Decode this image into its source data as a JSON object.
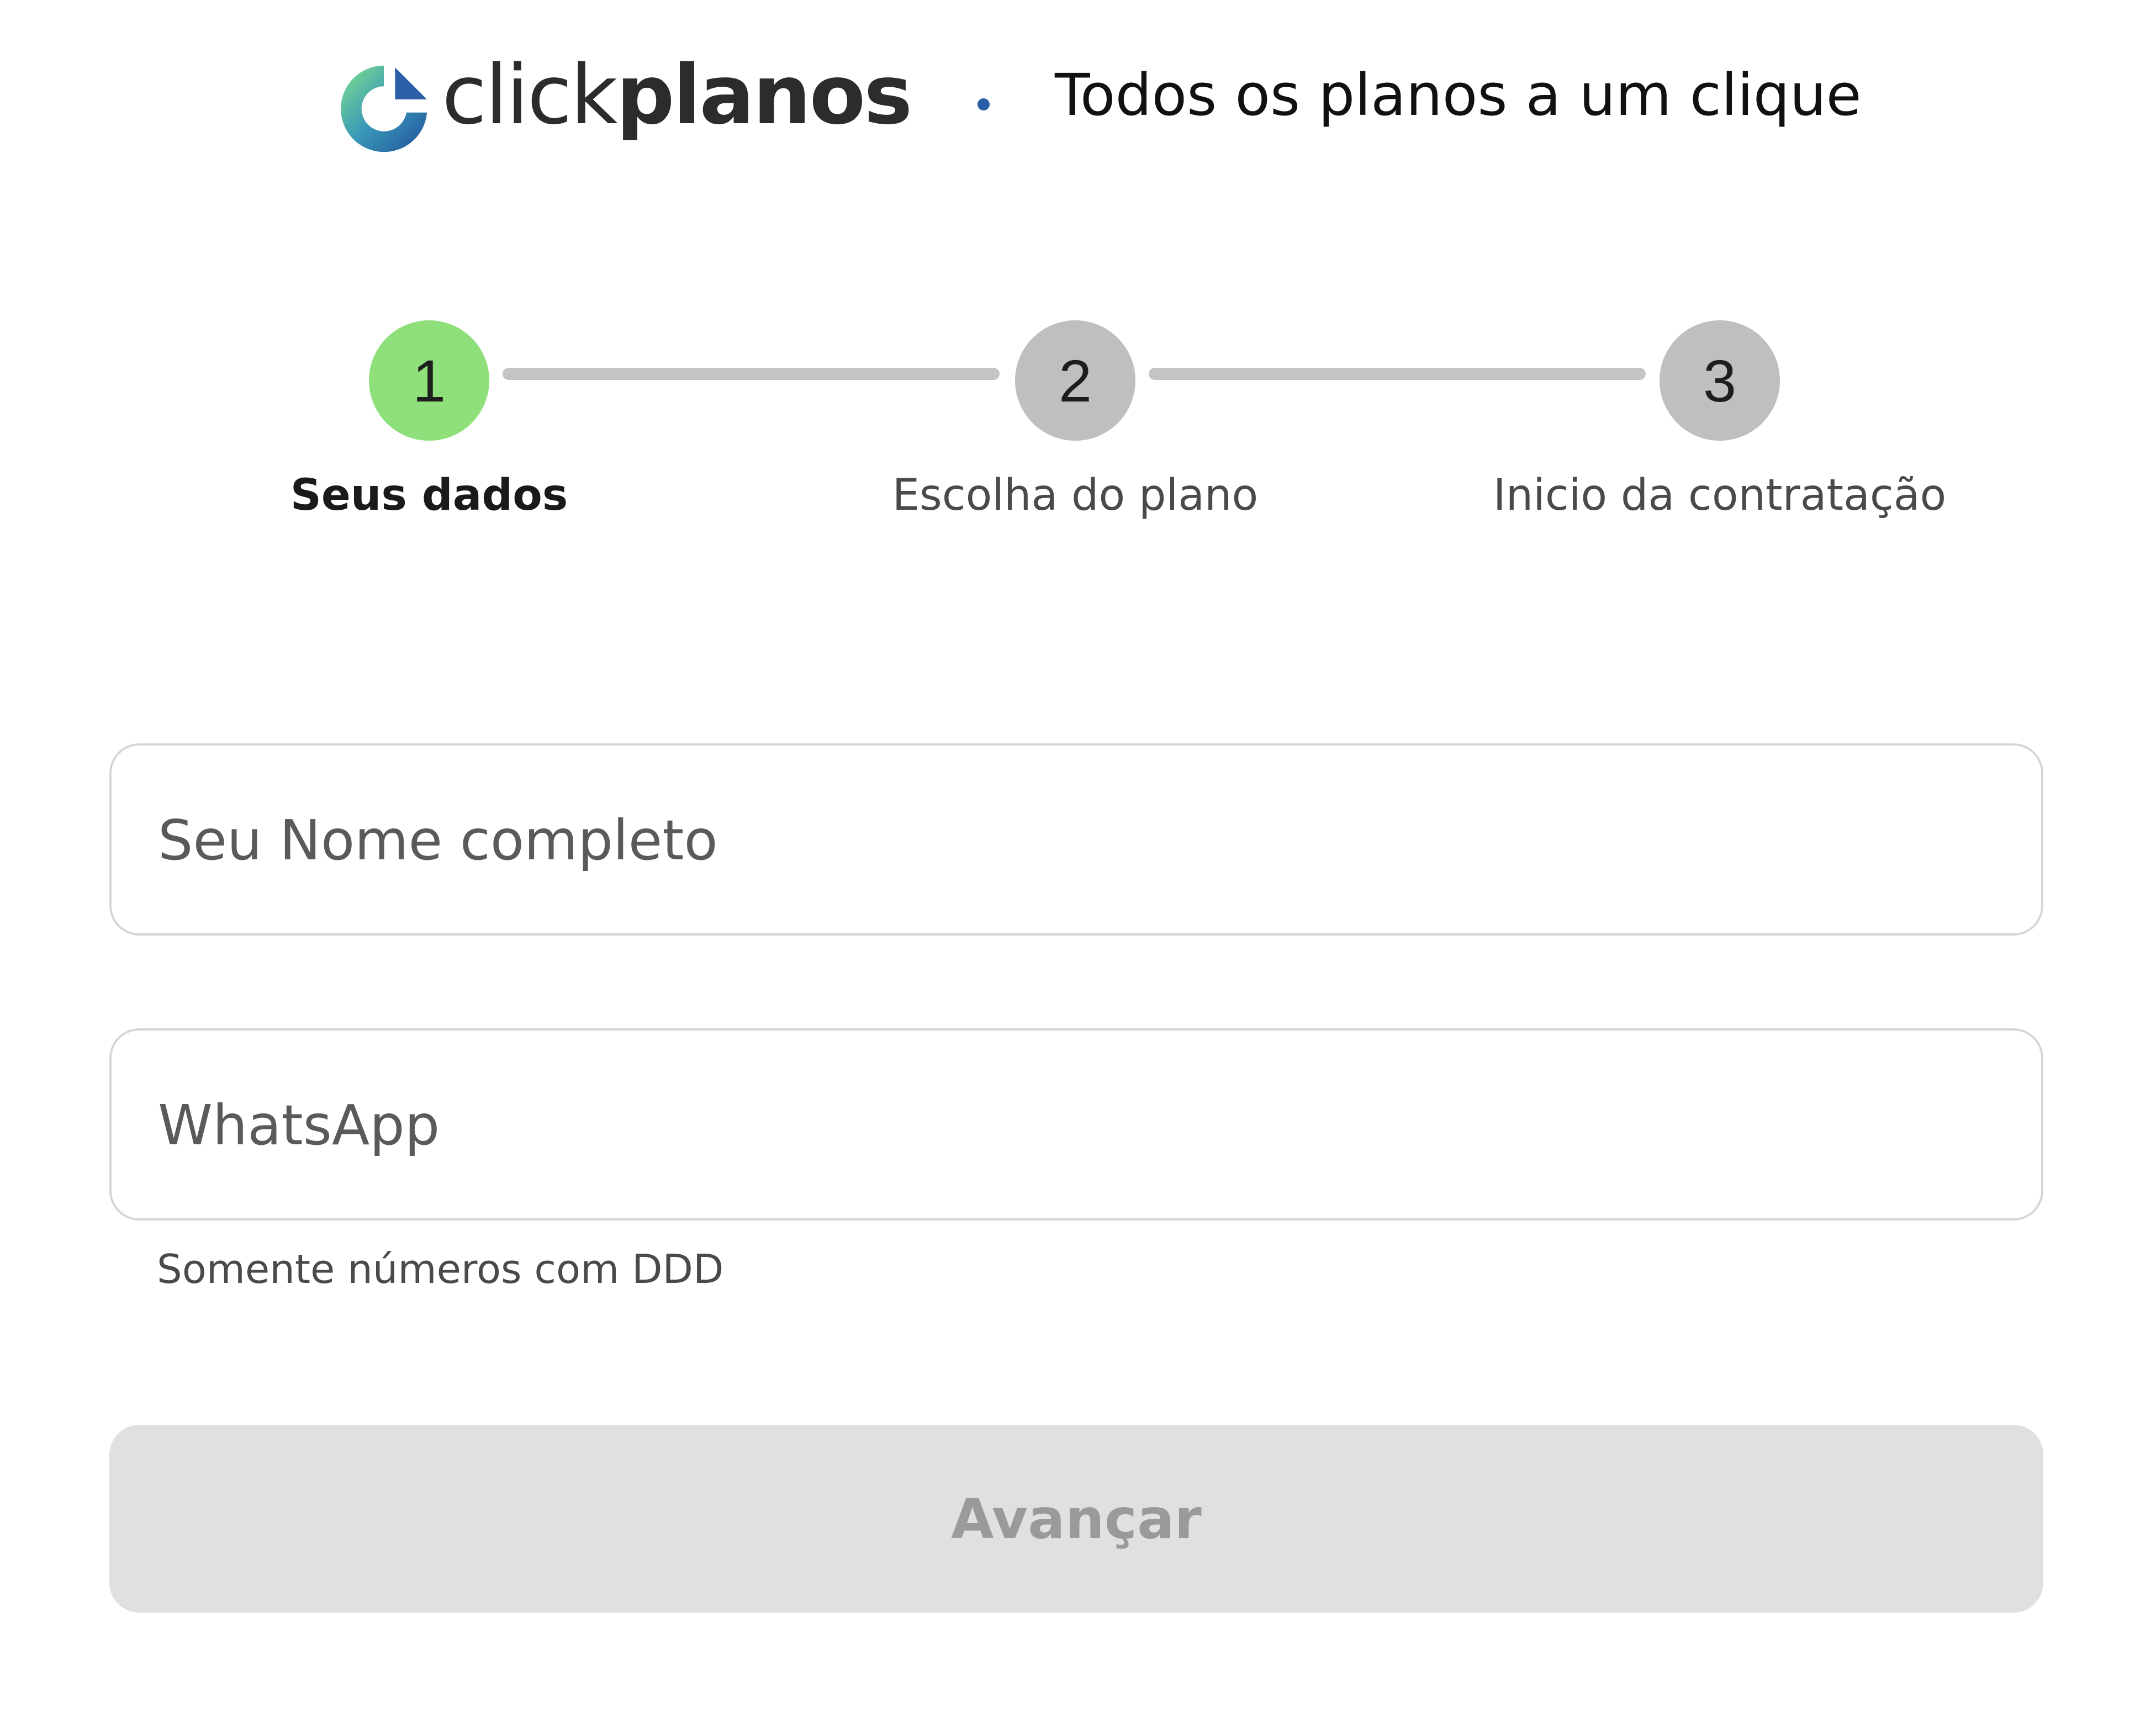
{
  "brand": {
    "logo_icon": "clickplanos-logo-icon",
    "name_light": "click",
    "name_bold": "planos",
    "separator": "•",
    "tagline": "Todos os planos a um clique",
    "colors": {
      "logo_blue": "#2a5fa8",
      "logo_green": "#6fd08c",
      "logo_teal": "#3a9ab8"
    }
  },
  "stepper": {
    "current_step": 1,
    "active_color": "#8fe07a",
    "inactive_color": "#bfbfbf",
    "steps": [
      {
        "number": "1",
        "label": "Seus dados",
        "active": true
      },
      {
        "number": "2",
        "label": "Escolha do plano",
        "active": false
      },
      {
        "number": "3",
        "label": "Inicio da contratação",
        "active": false
      }
    ]
  },
  "form": {
    "name_field": {
      "value": "",
      "placeholder": "Seu Nome completo"
    },
    "whatsapp_field": {
      "value": "",
      "placeholder": "WhatsApp",
      "helper": "Somente números com DDD"
    },
    "submit": {
      "label": "Avançar",
      "disabled": true
    }
  }
}
